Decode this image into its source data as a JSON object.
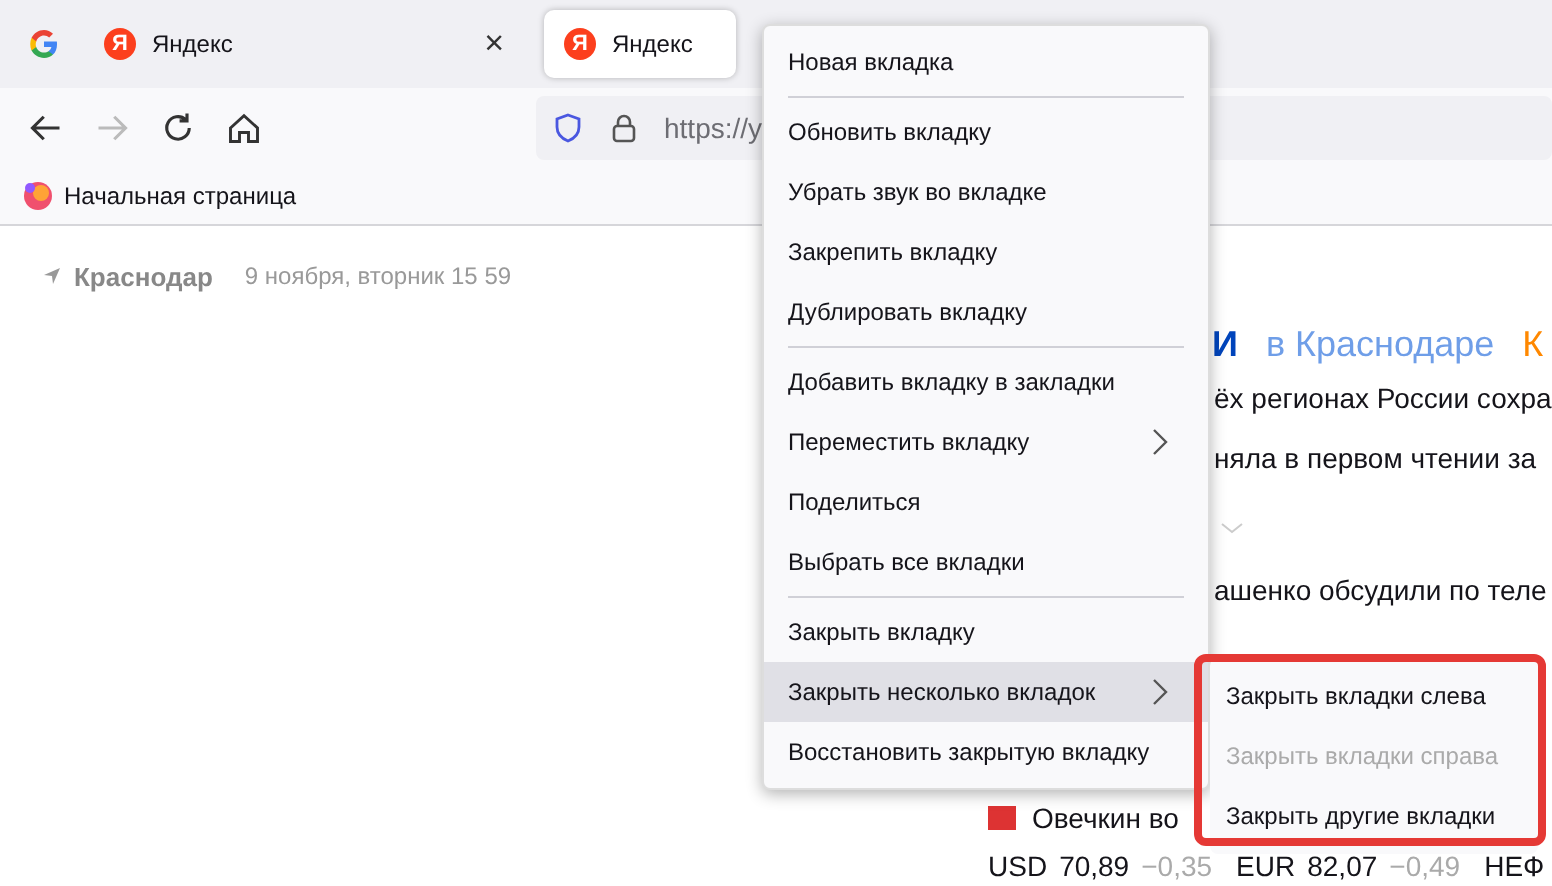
{
  "tabs": [
    {
      "kind": "pinned",
      "selected": false
    },
    {
      "kind": "site",
      "favicon_letter": "Я",
      "label": "Яндекс",
      "selected": false,
      "close": "×"
    },
    {
      "kind": "site",
      "favicon_letter": "Я",
      "label": "Яндекс",
      "selected": true
    }
  ],
  "address_bar": {
    "url": "https://y"
  },
  "bookmarks": [
    {
      "label": "Начальная страница"
    }
  ],
  "page": {
    "city": "Краснодар",
    "date": "9 ноября, вторник 15 59",
    "heading": {
      "part_1": "И",
      "part_2": "в Краснодаре",
      "part_3": "К"
    },
    "news": [
      {
        "text": "ёх регионах России сохра",
        "icon": false
      },
      {
        "text": "няла в первом чтении за",
        "icon": false
      },
      {
        "text": "ашенко обсудили по теле",
        "icon": false
      },
      {
        "text": "Овечкин во",
        "icon": true
      }
    ],
    "rates": [
      {
        "code": "USD",
        "value": "70,89",
        "change": "−0,35"
      },
      {
        "code": "EUR",
        "value": "82,07",
        "change": "−0,49"
      }
    ],
    "rate_cut": "НЕФ"
  },
  "menu": {
    "groups": [
      [
        {
          "label": "Новая вкладка",
          "submenu": false,
          "selected": false
        }
      ],
      [
        {
          "label": "Обновить вкладку",
          "submenu": false,
          "selected": false
        },
        {
          "label": "Убрать звук во вкладке",
          "submenu": false,
          "selected": false
        },
        {
          "label": "Закрепить вкладку",
          "submenu": false,
          "selected": false
        },
        {
          "label": "Дублировать вкладку",
          "submenu": false,
          "selected": false
        }
      ],
      [
        {
          "label": "Добавить вкладку в закладки",
          "submenu": false,
          "selected": false
        },
        {
          "label": "Переместить вкладку",
          "submenu": true,
          "selected": false
        },
        {
          "label": "Поделиться",
          "submenu": false,
          "selected": false
        },
        {
          "label": "Выбрать все вкладки",
          "submenu": false,
          "selected": false
        }
      ],
      [
        {
          "label": "Закрыть вкладку",
          "submenu": false,
          "selected": false
        },
        {
          "label": "Закрыть несколько вкладок",
          "submenu": true,
          "selected": true
        },
        {
          "label": "Восстановить закрытую вкладку",
          "submenu": false,
          "selected": false
        }
      ]
    ]
  },
  "submenu": {
    "highlighted": true,
    "items": [
      {
        "label": "Закрыть вкладки слева",
        "disabled": false
      },
      {
        "label": "Закрыть вкладки справа",
        "disabled": true
      },
      {
        "label": "Закрыть другие вкладки",
        "disabled": false
      }
    ]
  }
}
